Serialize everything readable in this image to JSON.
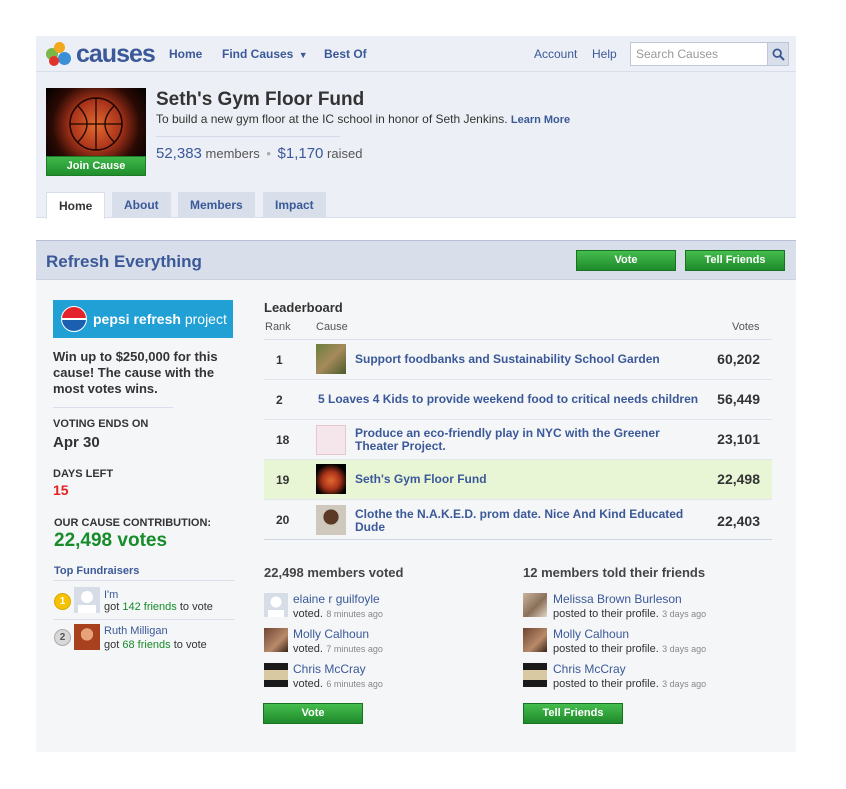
{
  "nav": {
    "logo_text": "causes",
    "home": "Home",
    "find_causes": "Find Causes",
    "best_of": "Best Of",
    "account": "Account",
    "help": "Help",
    "search_placeholder": "Search Causes"
  },
  "cause": {
    "title": "Seth's Gym Floor Fund",
    "description": "To build a new gym floor at the IC school in honor of Seth Jenkins.",
    "learn_more": "Learn More",
    "members_count": "52,383",
    "members_label": "members",
    "raised_amount": "$1,170",
    "raised_label": "raised",
    "join_button": "Join Cause"
  },
  "tabs": [
    {
      "label": "Home",
      "active": true
    },
    {
      "label": "About"
    },
    {
      "label": "Members"
    },
    {
      "label": "Impact"
    }
  ],
  "refresh": {
    "title": "Refresh Everything",
    "vote_button": "Vote",
    "tell_friends_button": "Tell Friends"
  },
  "sidebar": {
    "pepsi_logo_bold": "pepsi refresh",
    "pepsi_logo_light": "project",
    "description": "Win up to $250,000 for this cause! The cause with the most votes wins.",
    "voting_ends_label": "VOTING ENDS ON",
    "voting_ends_value": "Apr 30",
    "days_left_label": "DAYS LEFT",
    "days_left_value": "15",
    "contribution_label": "OUR CAUSE CONTRIBUTION:",
    "contribution_value": "22,498 votes",
    "top_fundraisers_title": "Top Fundraisers",
    "fundraisers": [
      {
        "rank": "1",
        "name": "I'm",
        "prefix": "got",
        "count": "142 friends",
        "suffix": "to vote"
      },
      {
        "rank": "2",
        "name": "Ruth Milligan",
        "prefix": "got",
        "count": "68 friends",
        "suffix": "to vote"
      }
    ]
  },
  "leaderboard": {
    "title": "Leaderboard",
    "col_rank": "Rank",
    "col_cause": "Cause",
    "col_votes": "Votes",
    "rows": [
      {
        "rank": "1",
        "cause": "Support foodbanks and Sustainability School Garden",
        "votes": "60,202"
      },
      {
        "rank": "2",
        "cause": "5 Loaves 4 Kids to provide weekend food to critical needs children",
        "votes": "56,449"
      },
      {
        "rank": "18",
        "cause": "Produce an eco-friendly play in NYC with the Greener Theater Project.",
        "votes": "23,101"
      },
      {
        "rank": "19",
        "cause": "Seth's Gym Floor Fund",
        "votes": "22,498"
      },
      {
        "rank": "20",
        "cause": "Clothe the N.A.K.E.D. prom date. Nice And Kind Educated Dude",
        "votes": "22,403"
      }
    ]
  },
  "voted": {
    "title": "22,498 members voted",
    "button": "Vote",
    "items": [
      {
        "name": "elaine r guilfoyle",
        "action": "voted.",
        "time": "8 minutes ago"
      },
      {
        "name": "Molly Calhoun",
        "action": "voted.",
        "time": "7 minutes ago"
      },
      {
        "name": "Chris McCray",
        "action": "voted.",
        "time": "6 minutes ago"
      }
    ]
  },
  "told": {
    "title": "12 members told their friends",
    "button": "Tell Friends",
    "items": [
      {
        "name": "Melissa Brown Burleson",
        "action": "posted to their profile.",
        "time": "3 days ago"
      },
      {
        "name": "Molly Calhoun",
        "action": "posted to their profile.",
        "time": "3 days ago"
      },
      {
        "name": "Chris McCray",
        "action": "posted to their profile.",
        "time": "3 days ago"
      }
    ]
  }
}
